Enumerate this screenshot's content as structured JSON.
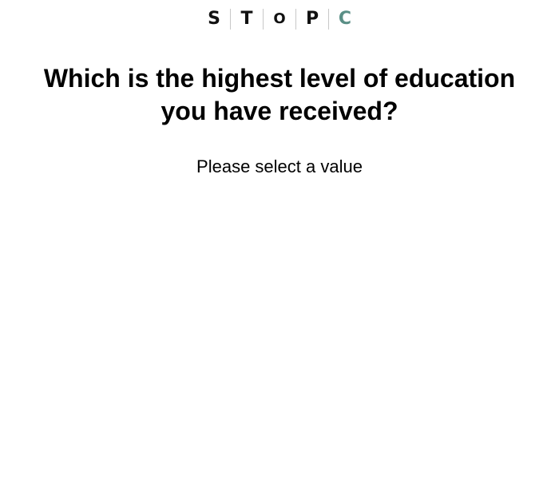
{
  "logo": {
    "letters": [
      "S",
      "T",
      "O",
      "P",
      "C"
    ],
    "accent_color": "#5a8f86"
  },
  "question": {
    "title": "Which is the highest level of education you have received?",
    "prompt": "Please select a value"
  }
}
